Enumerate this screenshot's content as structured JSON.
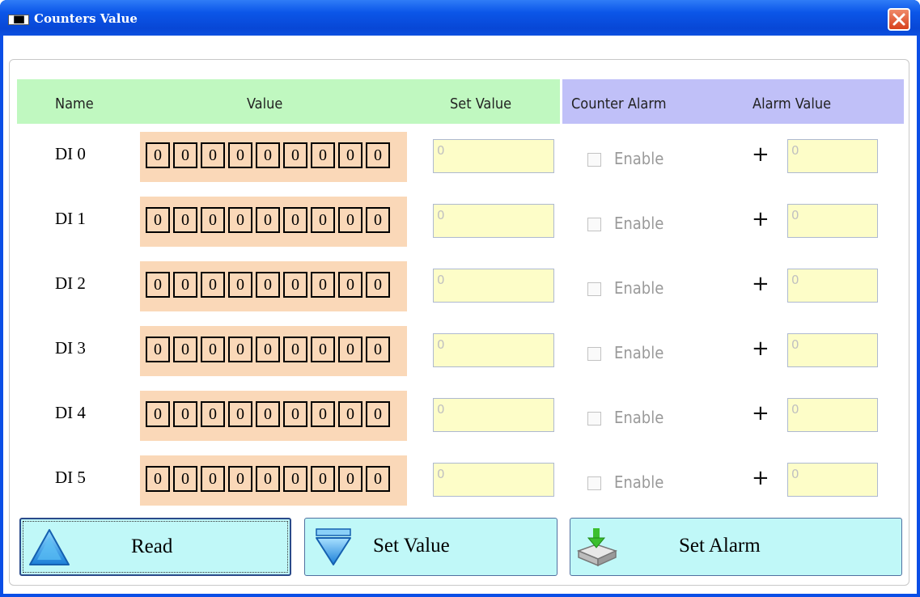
{
  "window": {
    "title": "Counters Value",
    "icon_text": "███"
  },
  "headers": {
    "name": "Name",
    "value": "Value",
    "set_value": "Set Value",
    "counter_alarm": "Counter Alarm",
    "alarm_value": "Alarm Value"
  },
  "rows": [
    {
      "label": "DI 0",
      "digits": [
        "0",
        "0",
        "0",
        "0",
        "0",
        "0",
        "0",
        "0",
        "0"
      ],
      "set_value": "0",
      "enable_label": "Enable",
      "enabled": false,
      "plus": "+",
      "alarm_value": "0"
    },
    {
      "label": "DI 1",
      "digits": [
        "0",
        "0",
        "0",
        "0",
        "0",
        "0",
        "0",
        "0",
        "0"
      ],
      "set_value": "0",
      "enable_label": "Enable",
      "enabled": false,
      "plus": "+",
      "alarm_value": "0"
    },
    {
      "label": "DI 2",
      "digits": [
        "0",
        "0",
        "0",
        "0",
        "0",
        "0",
        "0",
        "0",
        "0"
      ],
      "set_value": "0",
      "enable_label": "Enable",
      "enabled": false,
      "plus": "+",
      "alarm_value": "0"
    },
    {
      "label": "DI 3",
      "digits": [
        "0",
        "0",
        "0",
        "0",
        "0",
        "0",
        "0",
        "0",
        "0"
      ],
      "set_value": "0",
      "enable_label": "Enable",
      "enabled": false,
      "plus": "+",
      "alarm_value": "0"
    },
    {
      "label": "DI 4",
      "digits": [
        "0",
        "0",
        "0",
        "0",
        "0",
        "0",
        "0",
        "0",
        "0"
      ],
      "set_value": "0",
      "enable_label": "Enable",
      "enabled": false,
      "plus": "+",
      "alarm_value": "0"
    },
    {
      "label": "DI 5",
      "digits": [
        "0",
        "0",
        "0",
        "0",
        "0",
        "0",
        "0",
        "0",
        "0"
      ],
      "set_value": "0",
      "enable_label": "Enable",
      "enabled": false,
      "plus": "+",
      "alarm_value": "0"
    }
  ],
  "buttons": {
    "read": "Read",
    "set_value": "Set Value",
    "set_alarm": "Set Alarm"
  },
  "colors": {
    "header_green": "#c0f8c0",
    "header_blue": "#c0c0f8",
    "digit_bg": "#fad8b8",
    "field_bg": "#fdfdc8",
    "button_bg": "#c0f8f8"
  }
}
